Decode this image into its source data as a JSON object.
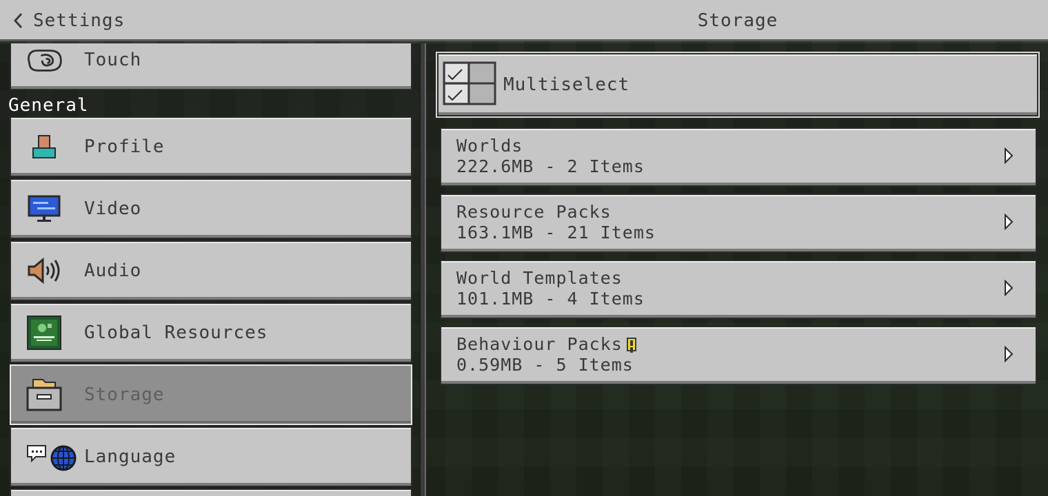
{
  "header": {
    "back_label": "Settings",
    "title": "Storage"
  },
  "sidebar": {
    "section_general": "General",
    "items": [
      {
        "label": "Touch",
        "icon": "touch-hand-icon"
      },
      {
        "label": "Profile",
        "icon": "profile-icon"
      },
      {
        "label": "Video",
        "icon": "video-monitor-icon"
      },
      {
        "label": "Audio",
        "icon": "speaker-icon"
      },
      {
        "label": "Global Resources",
        "icon": "global-resources-icon"
      },
      {
        "label": "Storage",
        "icon": "storage-box-icon",
        "selected": true
      },
      {
        "label": "Language",
        "icon": "language-globe-icon"
      }
    ]
  },
  "main": {
    "multiselect_label": "Multiselect",
    "rows": [
      {
        "title": "Worlds",
        "detail": "222.6MB - 2 Items"
      },
      {
        "title": "Resource Packs",
        "detail": "163.1MB - 21 Items"
      },
      {
        "title": "World Templates",
        "detail": "101.1MB - 4 Items"
      },
      {
        "title": "Behaviour Packs",
        "detail": "0.59MB - 5 Items",
        "warning": true
      }
    ]
  },
  "colors": {
    "button_face": "#c6c6c6",
    "button_selected": "#8f8f8f",
    "text": "#3a3a3a",
    "section_text": "#ffffff"
  }
}
